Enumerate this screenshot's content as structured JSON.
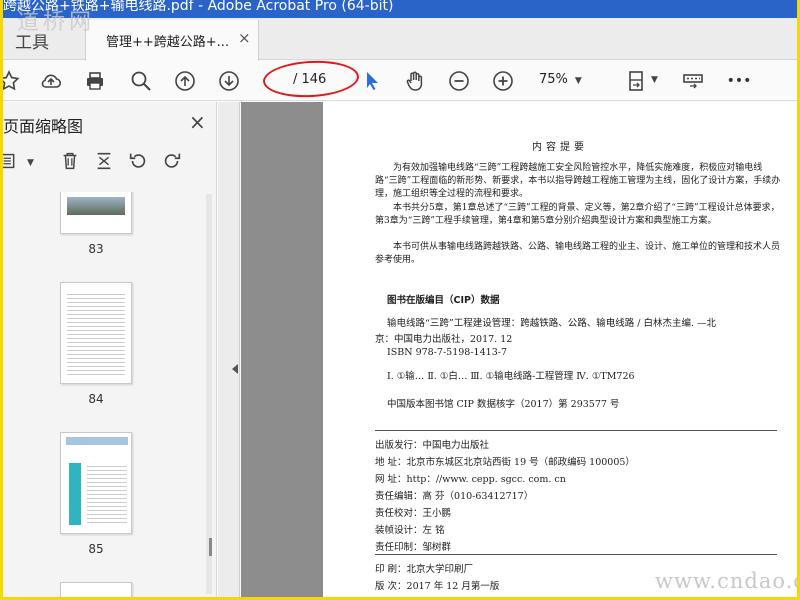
{
  "window": {
    "title": "跨越公路+铁路+输电线路.pdf - Adobe Acrobat Pro (64-bit)"
  },
  "watermark": {
    "top": "道桥网",
    "bottom": "www.cndao.com"
  },
  "tabs": {
    "tools": "工具",
    "doc": "管理++跨越公路+...",
    "close": "×"
  },
  "toolbar": {
    "page_current": "",
    "page_total": "/ 146",
    "zoom": "75%",
    "more": "•••"
  },
  "sidepanel": {
    "title": "页面缩略图",
    "close": "×",
    "thumbs": [
      {
        "num": "83"
      },
      {
        "num": "84"
      },
      {
        "num": "85"
      }
    ]
  },
  "document": {
    "heading": "内容提要",
    "para1": "为有效加强输电线路“三跨”工程跨越施工安全风险管控水平，降低实施难度，积极应对输电线路“三跨”工程面临的新形势、新要求，本书以指导跨越工程施工管理为主线，固化了设计方案，手续办理，施工组织等全过程的流程和要求。",
    "para2": "本书共分5章，第1章总述了“三跨”工程的背景、定义等，第2章介绍了“三跨”工程设计总体要求，第3章为“三跨”工程手续管理，第4章和第5章分别介绍典型设计方案和典型施工方案。",
    "para3": "本书可供从事输电线路跨越铁路、公路、输电线路工程的业主、设计、施工单位的管理和技术人员参考使用。",
    "cip_heading": "图书在版编目（CIP）数据",
    "cip_line1": "输电线路“三跨”工程建设管理：跨越铁路、公路、输电线路 / 白林杰主编. —北",
    "cip_line2": "京：中国电力出版社，2017. 12",
    "cip_isbn": "ISBN 978-7-5198-1413-7",
    "cip_class": "Ⅰ. ①输…   Ⅱ. ①白…   Ⅲ. ①输电线路-工程管理   Ⅳ. ①TM726",
    "cip_core": "中国版本图书馆 CIP 数据核字（2017）第 293577 号",
    "pub1": "出版发行：中国电力出版社",
    "pub2": "地      址：北京市东城区北京站西街 19 号（邮政编码 100005）",
    "pub3": "网      址：http：//www. cepp. sgcc. com. cn",
    "pub4": "责任编辑：高   芬（010-63412717）",
    "pub5": "责任校对：王小鹏",
    "pub6": "装帧设计：左   铭",
    "pub7": "责任印制：邹树群",
    "print1": "印      刷：北京大学印刷厂",
    "print2": "版      次：2017 年 12 月第一版"
  }
}
